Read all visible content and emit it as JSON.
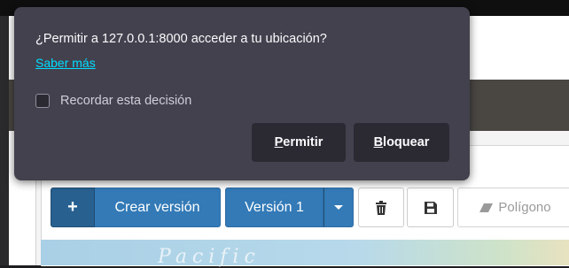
{
  "permission_popup": {
    "title": "¿Permitir a 127.0.0.1:8000 acceder a tu ubicación?",
    "learn_more_link": "Saber más",
    "remember_checkbox": {
      "label": "Recordar esta decisión",
      "checked": false
    },
    "allow_button": "Permitir",
    "block_button": "Bloquear",
    "colors": {
      "background": "#42414d",
      "link": "#00ddff",
      "button": "#2b2a33"
    }
  },
  "toolbar": {
    "add_icon": "plus-icon",
    "create_version_label": "Crear versión",
    "version_select": {
      "selected": "Versión 1",
      "icon": "caret-down-icon"
    },
    "delete_icon": "trash-icon",
    "save_icon": "floppy-disk-icon",
    "polygon": {
      "label": "Polígono",
      "icon": "eraser-icon",
      "enabled": false
    },
    "colors": {
      "primary": "#337ab7",
      "primary_dark": "#286090"
    }
  },
  "map": {
    "ocean_label": "Pacific"
  }
}
